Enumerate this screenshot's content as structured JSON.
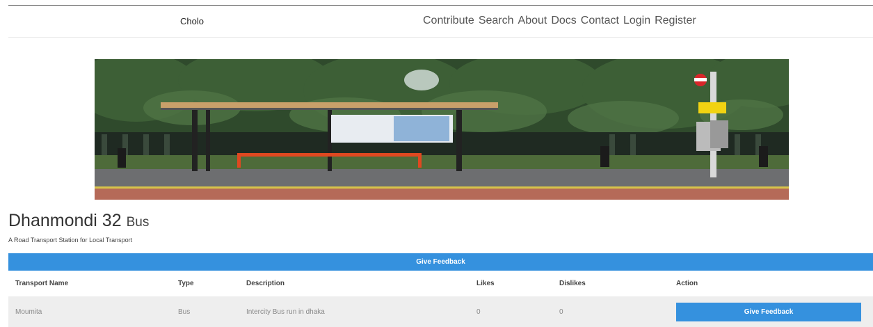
{
  "navbar": {
    "brand": "Cholo",
    "links": [
      "Contribute",
      "Search",
      "About",
      "Docs",
      "Contact",
      "Login",
      "Register"
    ]
  },
  "station": {
    "name": "Dhanmondi 32",
    "type": "Bus",
    "description": "A Road Transport Station for Local Transport"
  },
  "feedback_bar": {
    "label": "Give Feedback"
  },
  "table": {
    "headers": [
      "Transport Name",
      "Type",
      "Description",
      "Likes",
      "Dislikes",
      "Action"
    ],
    "rows": [
      {
        "name": "Moumita",
        "type": "Bus",
        "description": "Intercity Bus run in dhaka",
        "likes": "0",
        "dislikes": "0",
        "action": "Give Feedback"
      }
    ]
  }
}
